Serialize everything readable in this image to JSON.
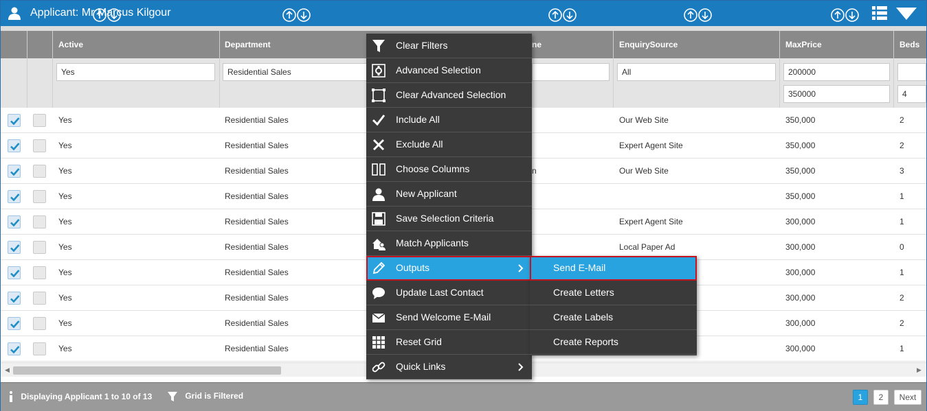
{
  "window": {
    "title": "Applicant: Mr Marcus Kilgour",
    "icons": [
      "user-icon",
      "list-view-icon",
      "dropdown-menu-icon"
    ]
  },
  "columns": [
    {
      "label": "Active"
    },
    {
      "label": "Department"
    },
    {
      "label": "ne"
    },
    {
      "label": "EnquirySource"
    },
    {
      "label": "MaxPrice"
    },
    {
      "label": "Beds"
    }
  ],
  "filters": {
    "active": "Yes",
    "department": "Residential Sales",
    "enquiry_source": "All",
    "maxprice_min": "200000",
    "maxprice_max": "350000",
    "beds_max": "4"
  },
  "rows": [
    {
      "checked": true,
      "active": "Yes",
      "department": "Residential Sales",
      "hidden": "",
      "source": "Our Web Site",
      "price": "350,000",
      "beds": "2"
    },
    {
      "checked": true,
      "active": "Yes",
      "department": "Residential Sales",
      "hidden": "",
      "source": "Expert Agent Site",
      "price": "350,000",
      "beds": "2"
    },
    {
      "checked": true,
      "active": "Yes",
      "department": "Residential Sales",
      "hidden": "n",
      "source": "Our Web Site",
      "price": "350,000",
      "beds": "3"
    },
    {
      "checked": true,
      "active": "Yes",
      "department": "Residential Sales",
      "hidden": "",
      "source": "",
      "price": "350,000",
      "beds": "1"
    },
    {
      "checked": true,
      "active": "Yes",
      "department": "Residential Sales",
      "hidden": "",
      "source": "Expert Agent Site",
      "price": "300,000",
      "beds": "1"
    },
    {
      "checked": true,
      "active": "Yes",
      "department": "Residential Sales",
      "hidden": "",
      "source": "Local Paper Ad",
      "price": "300,000",
      "beds": "0"
    },
    {
      "checked": true,
      "active": "Yes",
      "department": "Residential Sales",
      "hidden": "",
      "source": "",
      "price": "300,000",
      "beds": "1"
    },
    {
      "checked": true,
      "active": "Yes",
      "department": "Residential Sales",
      "hidden": "",
      "source": "",
      "price": "300,000",
      "beds": "2"
    },
    {
      "checked": true,
      "active": "Yes",
      "department": "Residential Sales",
      "hidden": "",
      "source": "",
      "price": "300,000",
      "beds": "2"
    },
    {
      "checked": true,
      "active": "Yes",
      "department": "Residential Sales",
      "hidden": "",
      "source": "",
      "price": "300,000",
      "beds": "1"
    }
  ],
  "context_menu": {
    "items": [
      {
        "label": "Clear Filters",
        "icon": "filter-icon"
      },
      {
        "label": "Advanced Selection",
        "icon": "advanced-selection-icon"
      },
      {
        "label": "Clear Advanced Selection",
        "icon": "clear-selection-icon"
      },
      {
        "label": "Include All",
        "icon": "checkmark-icon"
      },
      {
        "label": "Exclude All",
        "icon": "cross-icon"
      },
      {
        "label": "Choose Columns",
        "icon": "columns-icon"
      },
      {
        "label": "New Applicant",
        "icon": "user-icon"
      },
      {
        "label": "Save Selection Criteria",
        "icon": "save-icon"
      },
      {
        "label": "Match Applicants",
        "icon": "match-icon"
      },
      {
        "label": "Outputs",
        "icon": "pencil-icon",
        "submenu": true,
        "highlighted": true
      },
      {
        "label": "Update Last Contact",
        "icon": "speech-bubble-icon"
      },
      {
        "label": "Send Welcome E-Mail",
        "icon": "envelope-icon"
      },
      {
        "label": "Reset Grid",
        "icon": "grid-icon"
      },
      {
        "label": "Quick Links",
        "icon": "link-icon",
        "submenu": true
      }
    ]
  },
  "outputs_submenu": {
    "items": [
      {
        "label": "Send E-Mail",
        "highlighted": true
      },
      {
        "label": "Create Letters"
      },
      {
        "label": "Create Labels"
      },
      {
        "label": "Create Reports"
      }
    ]
  },
  "footer": {
    "status": "Displaying Applicant 1 to 10 of 13",
    "filter_status": "Grid is Filtered",
    "pages": [
      "1",
      "2"
    ],
    "current_page": "1",
    "next_label": "Next"
  },
  "colors": {
    "title_bar": "#1a7bbf",
    "accent": "#29a3df",
    "menu_bg": "#3a3a3a",
    "highlight_border": "#c4131f"
  }
}
